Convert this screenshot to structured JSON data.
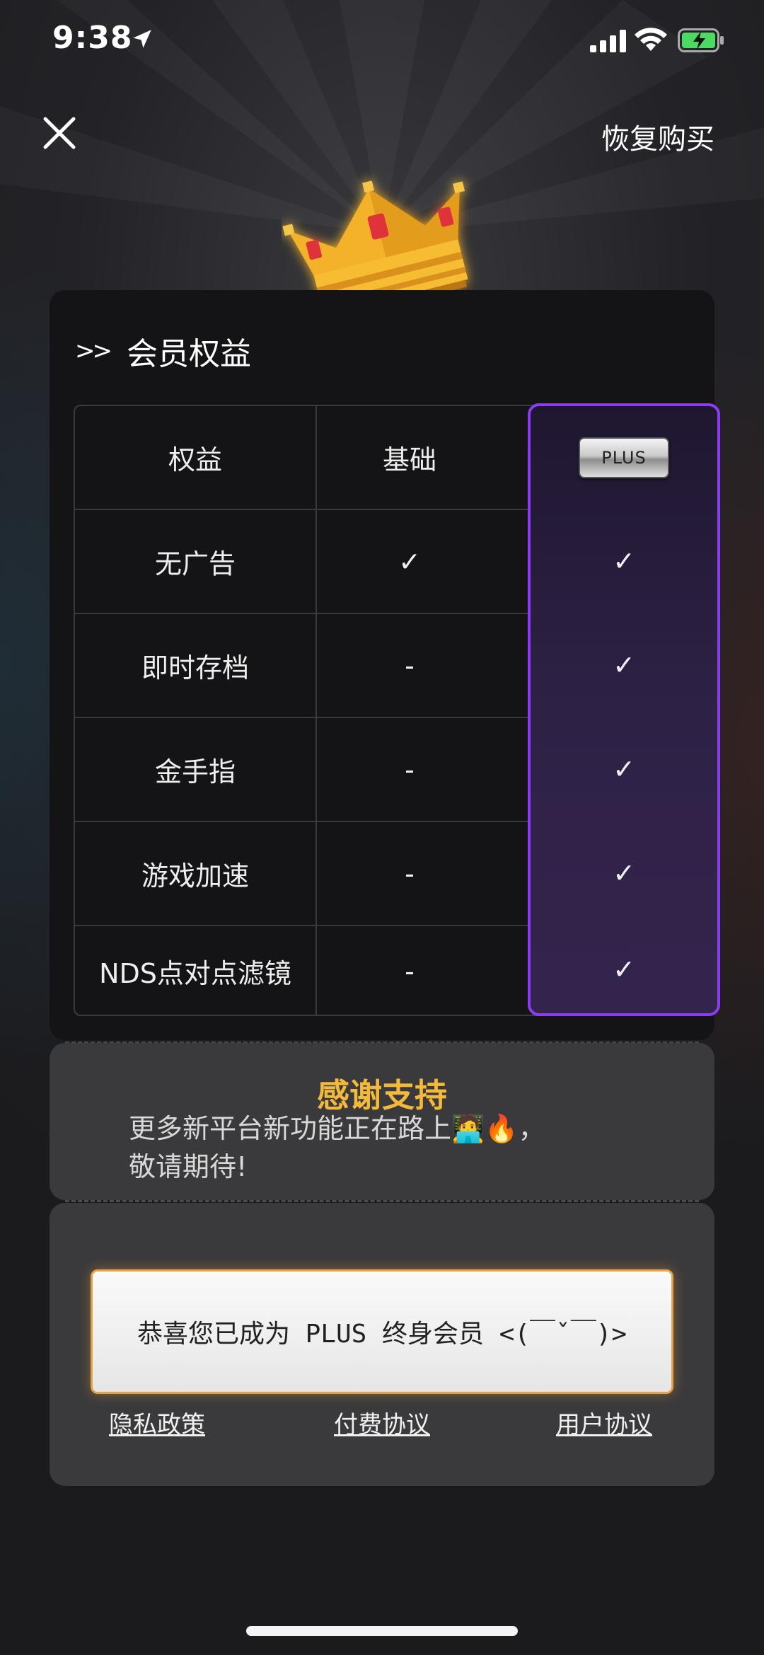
{
  "status_bar": {
    "time": "9:38"
  },
  "header": {
    "close_icon": "close-icon",
    "restore_label": "恢复购买"
  },
  "benefits": {
    "title": "会员权益",
    "columns": [
      "权益",
      "基础",
      "PLUS"
    ],
    "rows": [
      {
        "name": "无广告",
        "basic": "✓",
        "plus": "✓"
      },
      {
        "name": "即时存档",
        "basic": "-",
        "plus": "✓"
      },
      {
        "name": "金手指",
        "basic": "-",
        "plus": "✓"
      },
      {
        "name": "游戏加速",
        "basic": "-",
        "plus": "✓"
      },
      {
        "name": "NDS点对点滤镜",
        "basic": "-",
        "plus": "✓"
      }
    ]
  },
  "thanks": {
    "title": "感谢支持",
    "line1": "更多新平台新功能正在路上🧑‍💻🔥，",
    "line2": "敬请期待!"
  },
  "cta": {
    "label": "恭喜您已成为 PLUS 终身会员 <(￣ˇ￣)>"
  },
  "links": {
    "privacy": "隐私政策",
    "payment": "付费协议",
    "user": "用户协议"
  },
  "colors": {
    "accent_purple": "#8a3cf2",
    "gold": "#f2b93b",
    "cta_border": "#e6a246"
  }
}
